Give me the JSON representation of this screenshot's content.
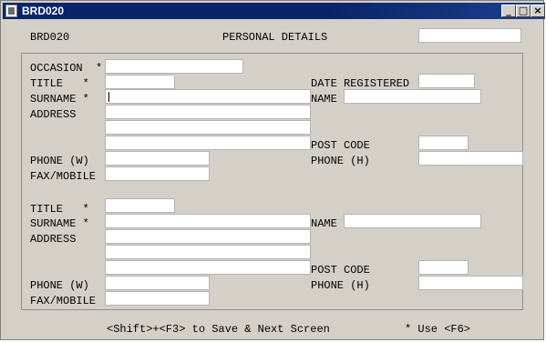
{
  "window": {
    "title": "BRD020",
    "icon": "app-icon",
    "minimize": "_",
    "restore": "□",
    "close": "×"
  },
  "header": {
    "form_code": "BRD020",
    "screen_title": "PERSONAL DETAILS",
    "top_field": ""
  },
  "primary": {
    "occasion_label": "OCCASION  *",
    "title_label": "TITLE   *",
    "surname_label": "SURNAME *",
    "address_label": "ADDRESS",
    "phone_w_label": "PHONE (W)",
    "fax_label": "FAX/MOBILE",
    "date_registered_label": "DATE REGISTERED",
    "name_label": "NAME",
    "post_code_label": "POST CODE",
    "phone_h_label": "PHONE (H)",
    "occasion": "",
    "title": "",
    "surname": "",
    "address1": "",
    "address2": "",
    "address3": "",
    "phone_w": "",
    "fax": "",
    "date_registered": "",
    "name": "",
    "post_code": "",
    "phone_h": ""
  },
  "secondary": {
    "title_label": "TITLE   *",
    "surname_label": "SURNAME *",
    "address_label": "ADDRESS",
    "phone_w_label": "PHONE (W)",
    "fax_label": "FAX/MOBILE",
    "name_label": "NAME",
    "post_code_label": "POST CODE",
    "phone_h_label": "PHONE (H)",
    "title": "",
    "surname": "",
    "address1": "",
    "address2": "",
    "address3": "",
    "phone_w": "",
    "fax": "",
    "name": "",
    "post_code": "",
    "phone_h": ""
  },
  "footer": {
    "save_hint": "<Shift>+<F3> to Save & Next Screen",
    "use_hint": "* Use <F6>"
  }
}
